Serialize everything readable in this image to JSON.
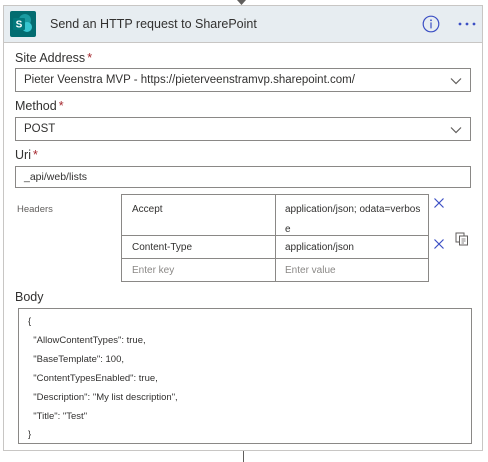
{
  "action": {
    "title": "Send an HTTP request to SharePoint",
    "icon": "sharepoint-icon",
    "icon_letter": "S",
    "brand_color": "#036c70",
    "accent_color": "#3b4fc4"
  },
  "fields": {
    "site_address": {
      "label": "Site Address",
      "required_mark": "*",
      "value": "Pieter Veenstra MVP - https://pieterveenstramvp.sharepoint.com/"
    },
    "method": {
      "label": "Method",
      "required_mark": "*",
      "value": "POST"
    },
    "uri": {
      "label": "Uri",
      "required_mark": "*",
      "value": "_api/web/lists"
    }
  },
  "headers": {
    "label": "Headers",
    "rows": [
      {
        "key": "Accept",
        "value": "application/json; odata=verbose"
      },
      {
        "key": "Content-Type",
        "value": "application/json"
      }
    ],
    "key_placeholder": "Enter key",
    "value_placeholder": "Enter value"
  },
  "body": {
    "label": "Body",
    "lines": [
      "{",
      "  \"AllowContentTypes\": true,",
      "  \"BaseTemplate\": 100,",
      "  \"ContentTypesEnabled\": true,",
      "  \"Description\": \"My list description\",",
      "  \"Title\": \"Test\"",
      "}"
    ]
  }
}
